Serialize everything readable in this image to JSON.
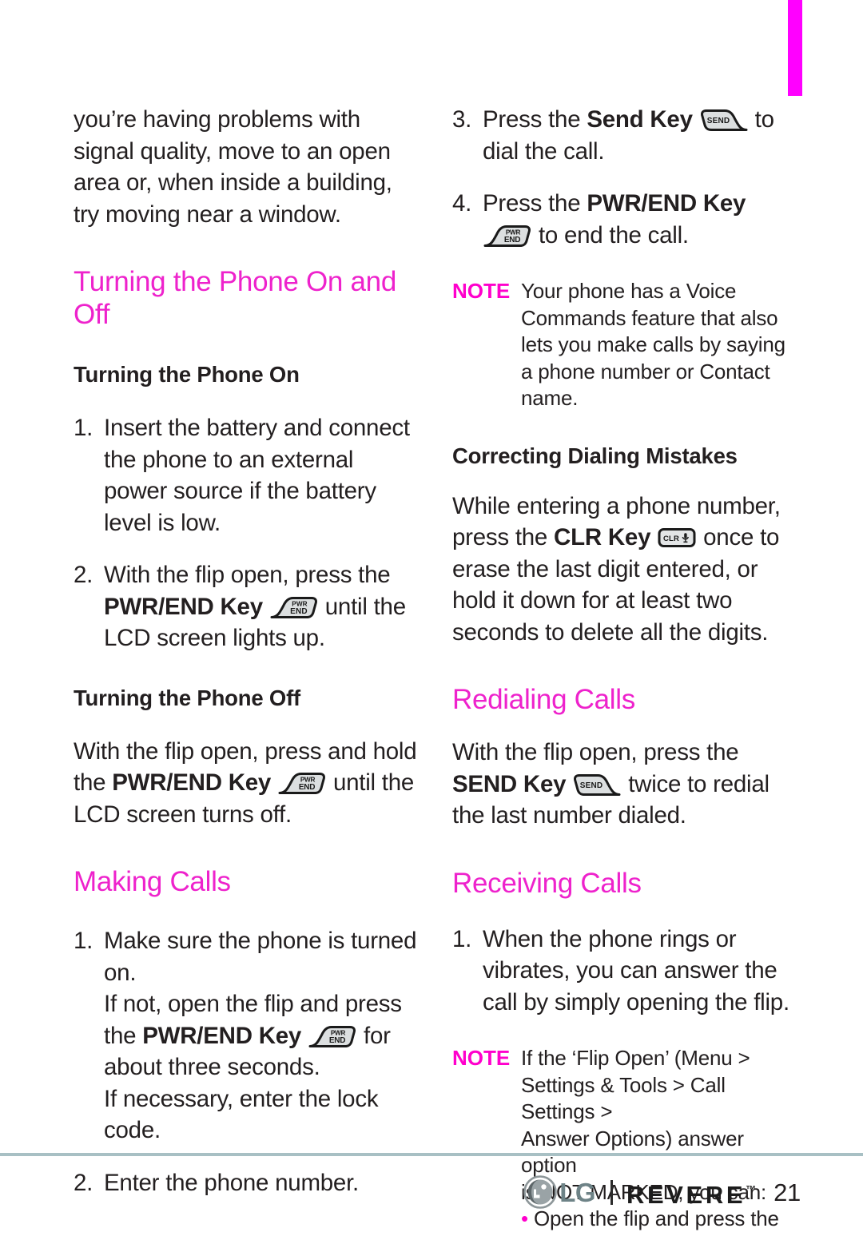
{
  "page": {
    "number": "21",
    "edge_tab_color": "#ff00ff",
    "heading_color": "#ee22cc",
    "note_color": "#ff00cc",
    "rule_color": "#a8c0c4"
  },
  "left_column": {
    "intro_paragraph": "you’re having problems with signal quality, move to an open area or, when inside a building, try moving near a window.",
    "section_heading": "Turning the Phone On and Off",
    "subheading_on": "Turning the Phone On",
    "step1_num": "1.",
    "step1_text": "Insert the battery and connect the phone to an external power source if the battery level is low.",
    "step2_num": "2.",
    "step2_part1": "With the flip open, press the ",
    "step2_bold": "PWR/END Key",
    "step2_icon": "pwr-end-key-icon",
    "step2_part2": " until the LCD screen lights up.",
    "subheading_off": "Turning the Phone Off",
    "off_part1": "With the flip open, press and hold the ",
    "off_bold": "PWR/END Key",
    "off_icon": "pwr-end-key-icon",
    "off_part2": " until the LCD screen turns off.",
    "making_calls_heading": "Making Calls",
    "mc_step1_num": "1.",
    "mc_step1_line1": "Make sure the phone is turned on.",
    "mc_step1_line2_part1": "If not, open the flip and press the ",
    "mc_step1_bold": "PWR/END Key",
    "mc_step1_icon": "pwr-end-key-icon",
    "mc_step1_line2_part2": " for about three seconds.",
    "mc_step1_line3": "If necessary, enter the lock code.",
    "mc_step2_num": "2.",
    "mc_step2_text": "Enter the phone number."
  },
  "right_column": {
    "step3_num": "3.",
    "step3_part1": "Press the ",
    "step3_bold": "Send Key",
    "step3_icon": "send-key-icon",
    "step3_part2": " to dial the call.",
    "step4_num": "4.",
    "step4_part1": "Press the ",
    "step4_bold": "PWR/END Key",
    "step4_icon": "pwr-end-key-icon",
    "step4_part2": " to end the call.",
    "note1_label": "NOTE",
    "note1_text": "Your phone has a Voice Commands feature that also lets you make calls by saying a phone number or Contact name.",
    "correcting_heading": "Correcting Dialing Mistakes",
    "correcting_part1": "While entering a phone number, press the ",
    "correcting_bold": "CLR Key",
    "correcting_icon": "clr-key-icon",
    "correcting_part2": " once to erase the last digit entered, or hold it down for at least two seconds to delete all the digits.",
    "redialing_heading": "Redialing Calls",
    "redial_part1": "With the flip open, press the ",
    "redial_bold1": "SEND",
    "redial_bold2": "Key",
    "redial_icon": "send-key-icon",
    "redial_part2": " twice to redial the last number dialed.",
    "receiving_heading": "Receiving Calls",
    "rc_step1_num": "1.",
    "rc_step1_text": "When the phone rings or vibrates, you can answer the call by simply opening the flip.",
    "note2_label": "NOTE",
    "note2_line1": "If the ‘Flip Open’ (Menu >",
    "note2_line2": "Settings & Tools > Call Settings >",
    "note2_line3": "Answer Options) answer option",
    "note2_line4": "is NOT MARKED, you can:",
    "note2_bullet": "•",
    "note2_bullet_text": "Open the flip and press the"
  },
  "key_icons": {
    "pwr_end_line1": "PWR",
    "pwr_end_line2": "END",
    "send_label": "SEND",
    "clr_label": "CLR"
  },
  "footer": {
    "lg_logo_icon": "lg-circle-logo-icon",
    "lg_word": "LG",
    "brand_name": "REVERE",
    "trademark": "™",
    "page_number": "21"
  }
}
